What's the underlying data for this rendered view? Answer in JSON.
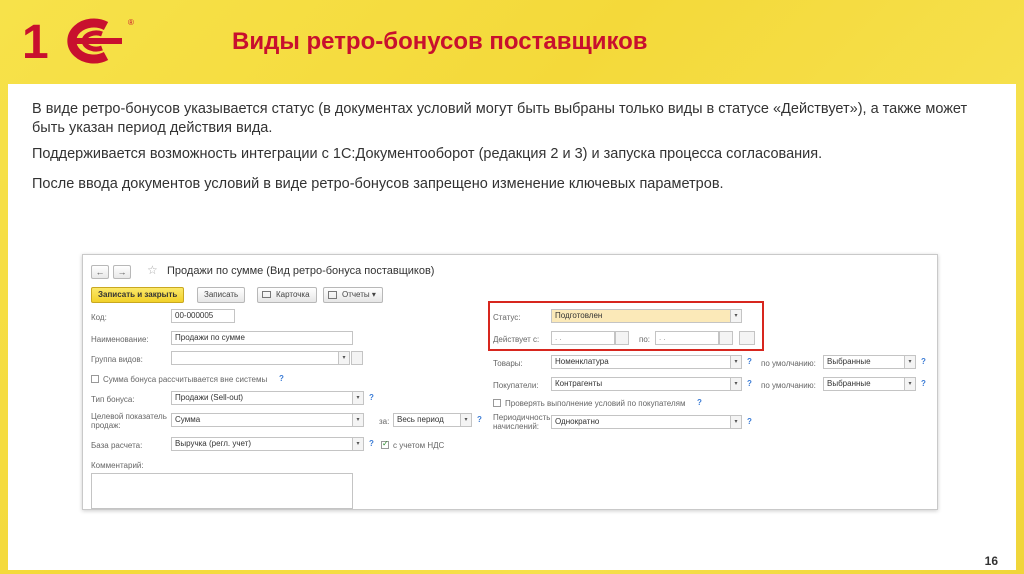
{
  "slide": {
    "logo_text": "1С",
    "logo_reg": "®",
    "title": "Виды ретро-бонусов поставщиков",
    "paragraphs": [
      "В виде ретро-бонусов указывается статус (в документах условий могут быть выбраны только виды в статусе «Действует»), а также может быть указан период действия вида.",
      "Поддерживается возможность интеграции с 1С:Документооборот (редакция 2 и 3) и запуска процесса согласования.",
      "После ввода документов условий в виде ретро-бонусов запрещено изменение ключевых параметров."
    ],
    "page_number": "16"
  },
  "form": {
    "title": "Продажи по сумме (Вид ретро-бонуса поставщиков)",
    "nav_back": "←",
    "nav_forward": "→",
    "star": "☆",
    "toolbar": {
      "save_close": "Записать и закрыть",
      "save": "Записать",
      "card": "Карточка",
      "reports": "Отчеты"
    },
    "left": {
      "code_label": "Код:",
      "code_value": "00-000005",
      "name_label": "Наименование:",
      "name_value": "Продажи по сумме",
      "group_label": "Группа видов:",
      "group_value": "",
      "external_calc_label": "Сумма бонуса рассчитывается вне системы",
      "bonus_type_label": "Тип бонуса:",
      "bonus_type_value": "Продажи (Sell-out)",
      "target_label": "Целевой показатель продаж:",
      "target_value": "Сумма",
      "for_label": "за:",
      "for_value": "Весь период",
      "base_label": "База расчета:",
      "base_value": "Выручка (регл. учет)",
      "vat_label": "с учетом НДС",
      "comment_label": "Комментарий:"
    },
    "right": {
      "status_label": "Статус:",
      "status_value": "Подготовлен",
      "active_from_label": "Действует с:",
      "active_from_value": ". .",
      "active_to_label": "по:",
      "active_to_value": ". .",
      "goods_label": "Товары:",
      "goods_value": "Номенклатура",
      "default_label": "по умолчанию:",
      "goods_default": "Выбранные",
      "buyers_label": "Покупатели:",
      "buyers_value": "Контрагенты",
      "buyers_default": "Выбранные",
      "check_buyers_label": "Проверять выполнение условий по покупателям",
      "periodicity_label": "Периодичность начислений:",
      "periodicity_value": "Однократно"
    },
    "help": "?",
    "dropdown": "▾"
  }
}
